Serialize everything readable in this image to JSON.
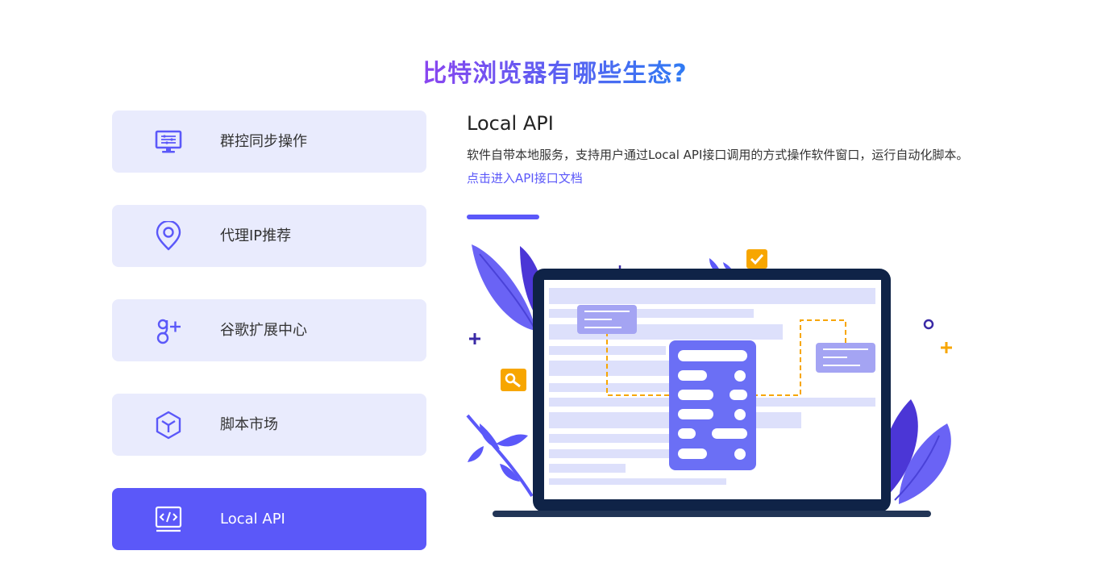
{
  "header": {
    "title": "比特浏览器有哪些生态?"
  },
  "menu": {
    "items": [
      {
        "label": "群控同步操作",
        "icon": "monitor-sync-icon"
      },
      {
        "label": "代理IP推荐",
        "icon": "location-pin-icon"
      },
      {
        "label": "谷歌扩展中心",
        "icon": "google-plus-icon"
      },
      {
        "label": "脚本市场",
        "icon": "cube-icon"
      },
      {
        "label": "Local API",
        "icon": "code-window-icon",
        "active": true
      }
    ]
  },
  "detail": {
    "heading": "Local API",
    "description": "软件自带本地服务，支持用户通过Local API接口调用的方式操作软件窗口，运行自动化脚本。",
    "link_text": "点击进入API接口文档"
  },
  "colors": {
    "accent": "#5b58f9",
    "item_bg": "#e9ebfd",
    "title_gradient_start": "#8a45f0",
    "title_gradient_end": "#2f7bf3",
    "illustration_orange": "#f7a600",
    "illustration_navy": "#0f2347"
  }
}
